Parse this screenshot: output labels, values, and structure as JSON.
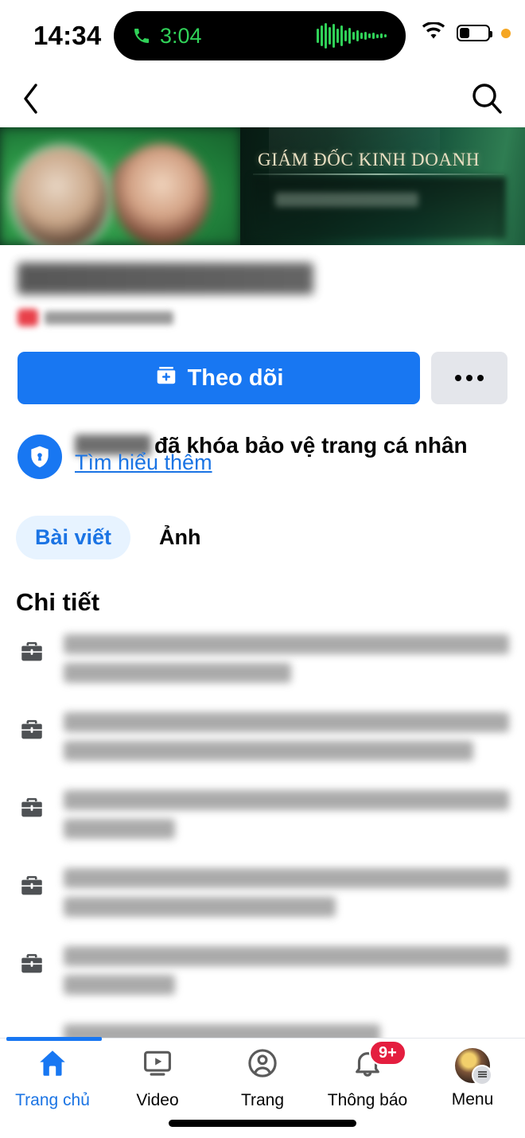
{
  "status_bar": {
    "time": "14:34",
    "call_duration": "3:04",
    "icons": {
      "phone": "phone-icon",
      "waveform": "audio-waveform-icon",
      "wifi": "wifi-icon",
      "battery": "battery-icon",
      "privacy": "orange-privacy-dot"
    }
  },
  "navbar": {
    "back": "back-chevron-icon",
    "search": "search-icon"
  },
  "cover": {
    "title": "GIÁM ĐỐC KINH DOANH"
  },
  "profile": {
    "name": "",
    "subtitle": ""
  },
  "actions": {
    "follow_label": "Theo dõi",
    "follow_icon": "follow-plus-icon",
    "more_icon": "more-options-icon",
    "follow_color": "#1877f2"
  },
  "locked_notice": {
    "name_redacted": "",
    "message": "đã khóa bảo vệ trang cá nhân",
    "learn_more": "Tìm hiểu thêm",
    "icon": "shield-lock-icon",
    "link_color": "#1b74e4"
  },
  "tabs": [
    {
      "label": "Bài viết",
      "active": true
    },
    {
      "label": "Ảnh",
      "active": false
    }
  ],
  "details": {
    "heading": "Chi tiết",
    "items": [
      {
        "icon": "briefcase-icon",
        "lines": 2,
        "widths": [
          100,
          51
        ],
        "text": ""
      },
      {
        "icon": "briefcase-icon",
        "lines": 2,
        "widths": [
          100,
          92
        ],
        "text": ""
      },
      {
        "icon": "briefcase-icon",
        "lines": 2,
        "widths": [
          100,
          25
        ],
        "text": ""
      },
      {
        "icon": "briefcase-icon",
        "lines": 2,
        "widths": [
          100,
          61
        ],
        "text": ""
      },
      {
        "icon": "briefcase-icon",
        "lines": 2,
        "widths": [
          100,
          25
        ],
        "text": ""
      },
      {
        "icon": "ellipsis-icon",
        "lines": 1,
        "widths": [
          71
        ],
        "text": ""
      }
    ]
  },
  "bottom_nav": {
    "items": [
      {
        "label": "Trang chủ",
        "icon": "home-icon",
        "active": true,
        "badge": ""
      },
      {
        "label": "Video",
        "icon": "video-icon",
        "active": false,
        "badge": ""
      },
      {
        "label": "Trang",
        "icon": "pages-person-icon",
        "active": false,
        "badge": ""
      },
      {
        "label": "Thông báo",
        "icon": "bell-icon",
        "active": false,
        "badge": "9+"
      },
      {
        "label": "Menu",
        "icon": "avatar-menu-icon",
        "active": false,
        "badge": ""
      }
    ],
    "active_color": "#1b74e4",
    "badge_color": "#e41e3f"
  }
}
